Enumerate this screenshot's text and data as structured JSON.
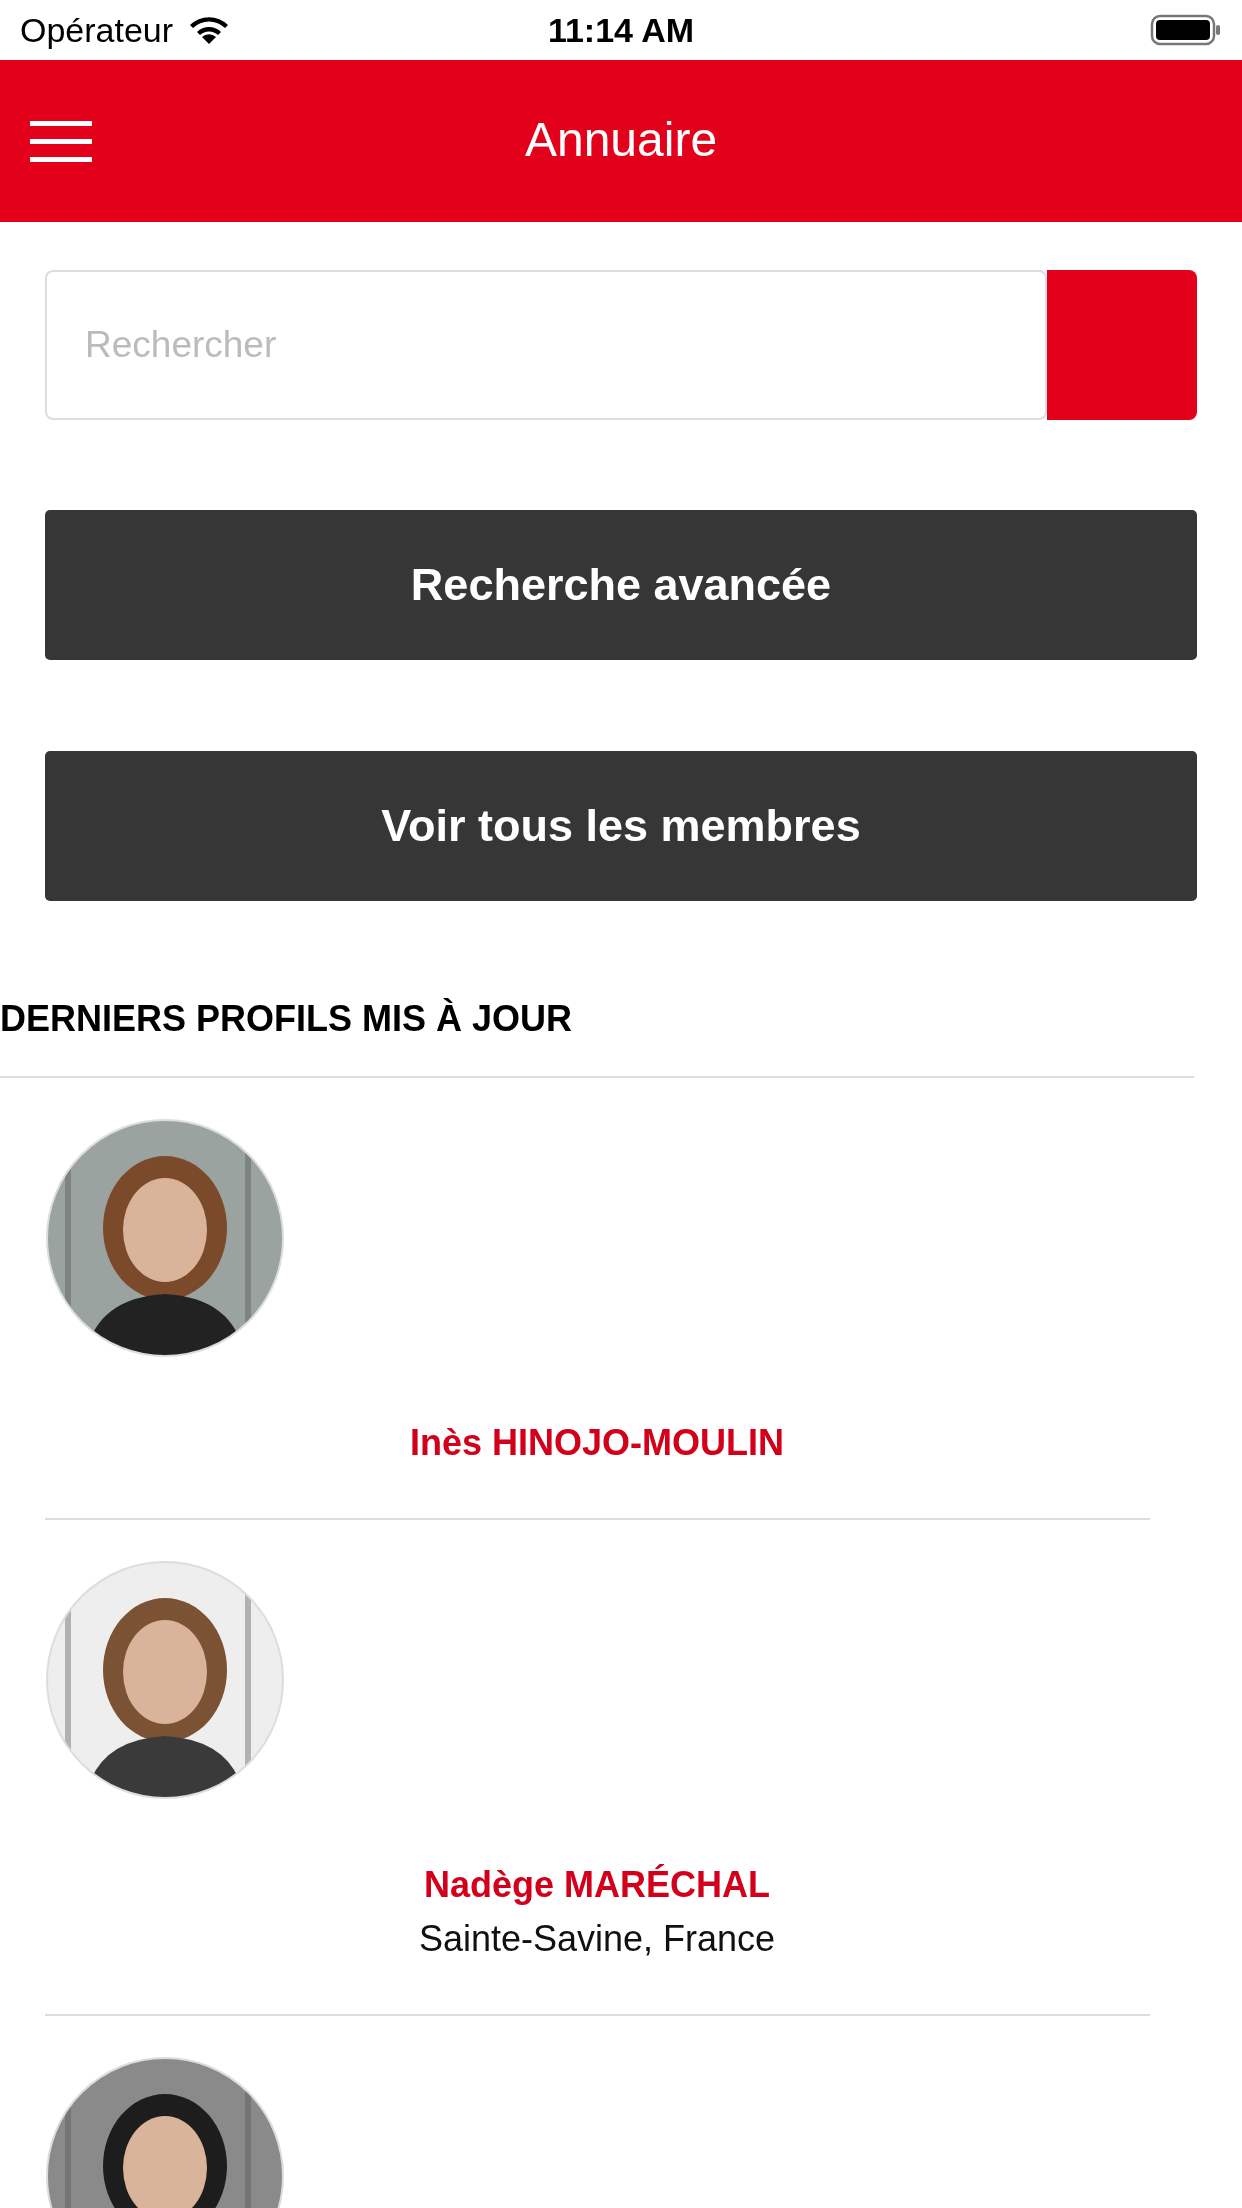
{
  "status_bar": {
    "carrier": "Opérateur",
    "time": "11:14 AM"
  },
  "header": {
    "title": "Annuaire"
  },
  "search": {
    "placeholder": "Rechercher"
  },
  "buttons": [
    "Recherche avancée",
    "Voir tous les membres"
  ],
  "section_title": "DERNIERS PROFILS MIS À JOUR",
  "profiles": [
    {
      "photo": {
        "kind": "picture"
      },
      "name": "Inès HINOJO-MOULIN"
    },
    {
      "photo": {
        "kind": "picture"
      },
      "name": "Nadège MARÉCHAL",
      "location": "Sainte-Savine, France"
    },
    {
      "photo": {
        "kind": "picture"
      }
    }
  ]
}
